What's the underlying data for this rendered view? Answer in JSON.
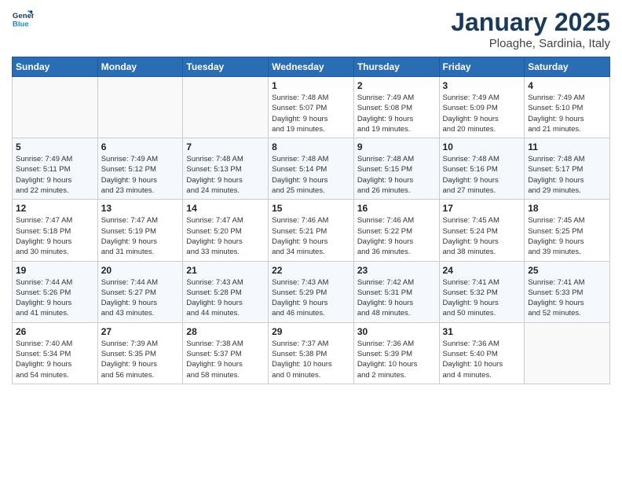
{
  "header": {
    "logo_line1": "General",
    "logo_line2": "Blue",
    "month": "January 2025",
    "location": "Ploaghe, Sardinia, Italy"
  },
  "weekdays": [
    "Sunday",
    "Monday",
    "Tuesday",
    "Wednesday",
    "Thursday",
    "Friday",
    "Saturday"
  ],
  "weeks": [
    [
      {
        "day": "",
        "info": ""
      },
      {
        "day": "",
        "info": ""
      },
      {
        "day": "",
        "info": ""
      },
      {
        "day": "1",
        "info": "Sunrise: 7:48 AM\nSunset: 5:07 PM\nDaylight: 9 hours\nand 19 minutes."
      },
      {
        "day": "2",
        "info": "Sunrise: 7:49 AM\nSunset: 5:08 PM\nDaylight: 9 hours\nand 19 minutes."
      },
      {
        "day": "3",
        "info": "Sunrise: 7:49 AM\nSunset: 5:09 PM\nDaylight: 9 hours\nand 20 minutes."
      },
      {
        "day": "4",
        "info": "Sunrise: 7:49 AM\nSunset: 5:10 PM\nDaylight: 9 hours\nand 21 minutes."
      }
    ],
    [
      {
        "day": "5",
        "info": "Sunrise: 7:49 AM\nSunset: 5:11 PM\nDaylight: 9 hours\nand 22 minutes."
      },
      {
        "day": "6",
        "info": "Sunrise: 7:49 AM\nSunset: 5:12 PM\nDaylight: 9 hours\nand 23 minutes."
      },
      {
        "day": "7",
        "info": "Sunrise: 7:48 AM\nSunset: 5:13 PM\nDaylight: 9 hours\nand 24 minutes."
      },
      {
        "day": "8",
        "info": "Sunrise: 7:48 AM\nSunset: 5:14 PM\nDaylight: 9 hours\nand 25 minutes."
      },
      {
        "day": "9",
        "info": "Sunrise: 7:48 AM\nSunset: 5:15 PM\nDaylight: 9 hours\nand 26 minutes."
      },
      {
        "day": "10",
        "info": "Sunrise: 7:48 AM\nSunset: 5:16 PM\nDaylight: 9 hours\nand 27 minutes."
      },
      {
        "day": "11",
        "info": "Sunrise: 7:48 AM\nSunset: 5:17 PM\nDaylight: 9 hours\nand 29 minutes."
      }
    ],
    [
      {
        "day": "12",
        "info": "Sunrise: 7:47 AM\nSunset: 5:18 PM\nDaylight: 9 hours\nand 30 minutes."
      },
      {
        "day": "13",
        "info": "Sunrise: 7:47 AM\nSunset: 5:19 PM\nDaylight: 9 hours\nand 31 minutes."
      },
      {
        "day": "14",
        "info": "Sunrise: 7:47 AM\nSunset: 5:20 PM\nDaylight: 9 hours\nand 33 minutes."
      },
      {
        "day": "15",
        "info": "Sunrise: 7:46 AM\nSunset: 5:21 PM\nDaylight: 9 hours\nand 34 minutes."
      },
      {
        "day": "16",
        "info": "Sunrise: 7:46 AM\nSunset: 5:22 PM\nDaylight: 9 hours\nand 36 minutes."
      },
      {
        "day": "17",
        "info": "Sunrise: 7:45 AM\nSunset: 5:24 PM\nDaylight: 9 hours\nand 38 minutes."
      },
      {
        "day": "18",
        "info": "Sunrise: 7:45 AM\nSunset: 5:25 PM\nDaylight: 9 hours\nand 39 minutes."
      }
    ],
    [
      {
        "day": "19",
        "info": "Sunrise: 7:44 AM\nSunset: 5:26 PM\nDaylight: 9 hours\nand 41 minutes."
      },
      {
        "day": "20",
        "info": "Sunrise: 7:44 AM\nSunset: 5:27 PM\nDaylight: 9 hours\nand 43 minutes."
      },
      {
        "day": "21",
        "info": "Sunrise: 7:43 AM\nSunset: 5:28 PM\nDaylight: 9 hours\nand 44 minutes."
      },
      {
        "day": "22",
        "info": "Sunrise: 7:43 AM\nSunset: 5:29 PM\nDaylight: 9 hours\nand 46 minutes."
      },
      {
        "day": "23",
        "info": "Sunrise: 7:42 AM\nSunset: 5:31 PM\nDaylight: 9 hours\nand 48 minutes."
      },
      {
        "day": "24",
        "info": "Sunrise: 7:41 AM\nSunset: 5:32 PM\nDaylight: 9 hours\nand 50 minutes."
      },
      {
        "day": "25",
        "info": "Sunrise: 7:41 AM\nSunset: 5:33 PM\nDaylight: 9 hours\nand 52 minutes."
      }
    ],
    [
      {
        "day": "26",
        "info": "Sunrise: 7:40 AM\nSunset: 5:34 PM\nDaylight: 9 hours\nand 54 minutes."
      },
      {
        "day": "27",
        "info": "Sunrise: 7:39 AM\nSunset: 5:35 PM\nDaylight: 9 hours\nand 56 minutes."
      },
      {
        "day": "28",
        "info": "Sunrise: 7:38 AM\nSunset: 5:37 PM\nDaylight: 9 hours\nand 58 minutes."
      },
      {
        "day": "29",
        "info": "Sunrise: 7:37 AM\nSunset: 5:38 PM\nDaylight: 10 hours\nand 0 minutes."
      },
      {
        "day": "30",
        "info": "Sunrise: 7:36 AM\nSunset: 5:39 PM\nDaylight: 10 hours\nand 2 minutes."
      },
      {
        "day": "31",
        "info": "Sunrise: 7:36 AM\nSunset: 5:40 PM\nDaylight: 10 hours\nand 4 minutes."
      },
      {
        "day": "",
        "info": ""
      }
    ]
  ]
}
